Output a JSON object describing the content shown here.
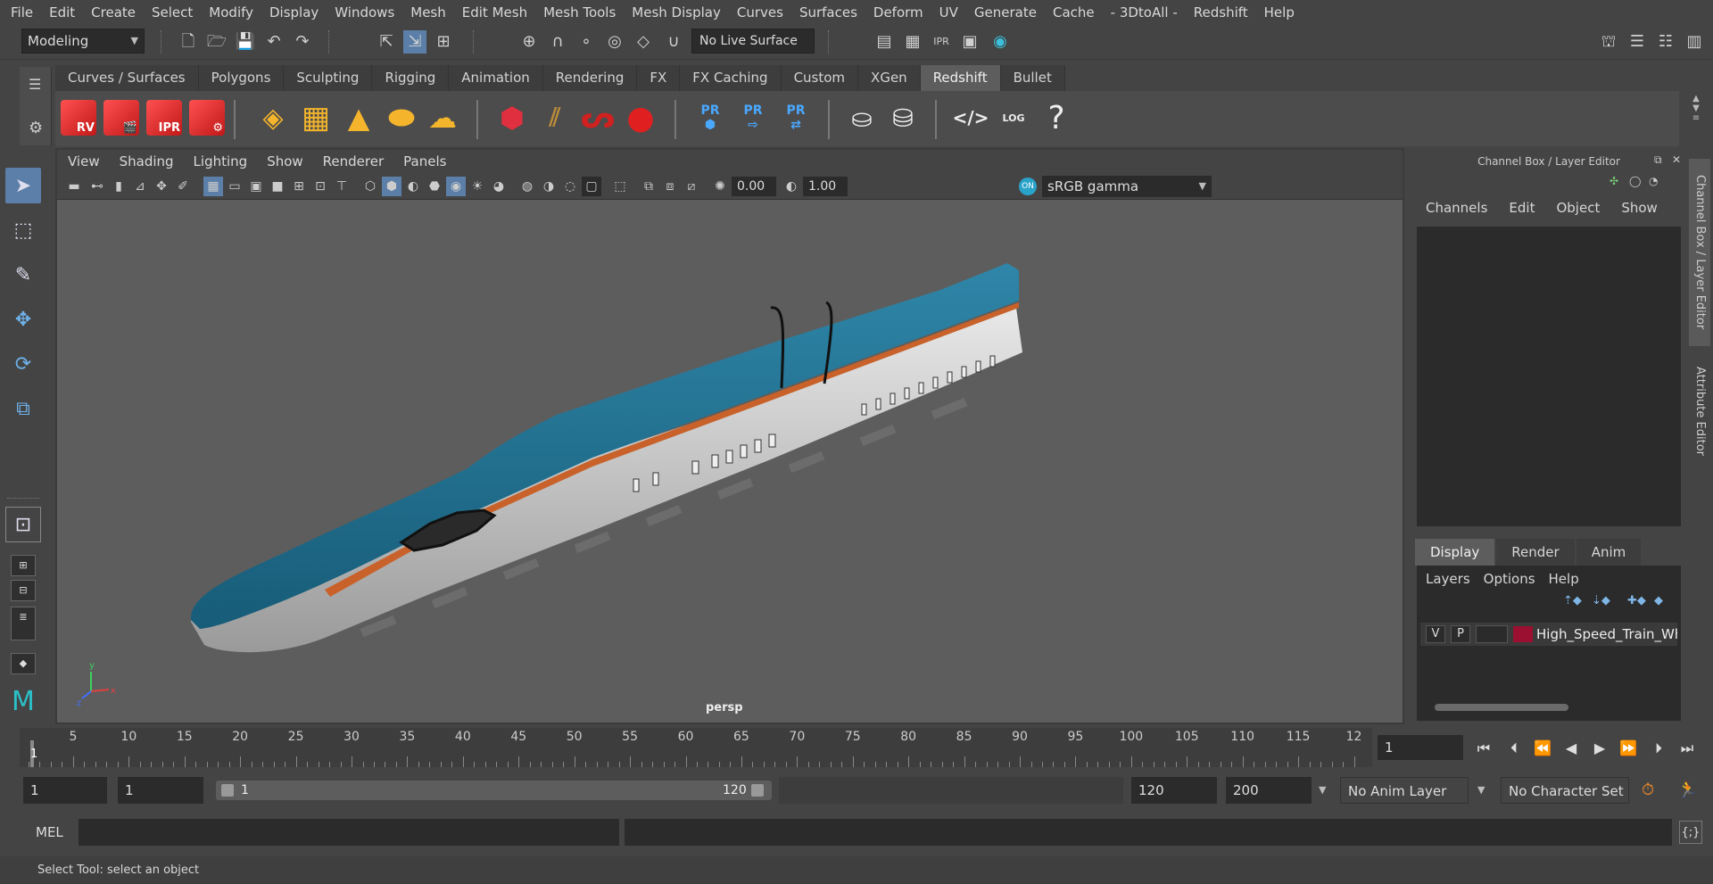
{
  "menubar": {
    "items": [
      "File",
      "Edit",
      "Create",
      "Select",
      "Modify",
      "Display",
      "Windows",
      "Mesh",
      "Edit Mesh",
      "Mesh Tools",
      "Mesh Display",
      "Curves",
      "Surfaces",
      "Deform",
      "UV",
      "Generate",
      "Cache",
      "- 3DtoAll -",
      "Redshift",
      "Help"
    ]
  },
  "statusline": {
    "workspace": "Modeling",
    "live_surface": "No Live Surface"
  },
  "shelf": {
    "tabs": [
      "Curves / Surfaces",
      "Polygons",
      "Sculpting",
      "Rigging",
      "Animation",
      "Rendering",
      "FX",
      "FX Caching",
      "Custom",
      "XGen",
      "Redshift",
      "Bullet"
    ],
    "active_tab": "Redshift",
    "rs_labels": [
      "RV",
      "",
      "IPR",
      ""
    ],
    "pr_label": "PR",
    "log_label": "LOG",
    "help_glyph": "?"
  },
  "viewport": {
    "menu": [
      "View",
      "Shading",
      "Lighting",
      "Show",
      "Renderer",
      "Panels"
    ],
    "exposure": "0.00",
    "gamma": "1.00",
    "color_space": "sRGB gamma",
    "camera": "persp",
    "axis_labels": {
      "x": "x",
      "y": "y",
      "z": "z"
    }
  },
  "channel_box": {
    "title": "Channel Box / Layer Editor",
    "menu": [
      "Channels",
      "Edit",
      "Object",
      "Show"
    ]
  },
  "layer_editor": {
    "tabs": [
      "Display",
      "Render",
      "Anim"
    ],
    "active_tab": "Display",
    "menu": [
      "Layers",
      "Options",
      "Help"
    ],
    "layer": {
      "v": "V",
      "p": "P",
      "name": "High_Speed_Train_Wh",
      "color": "#9b1030"
    }
  },
  "side_tabs": [
    "Channel Box / Layer Editor",
    "Attribute Editor"
  ],
  "timeslider": {
    "ticks": [
      "5",
      "10",
      "15",
      "20",
      "25",
      "30",
      "35",
      "40",
      "45",
      "50",
      "55",
      "60",
      "65",
      "70",
      "75",
      "80",
      "85",
      "90",
      "95",
      "100",
      "105",
      "110",
      "115",
      "12"
    ],
    "current_frame_marker": "1",
    "current_time": "1"
  },
  "range": {
    "start": "1",
    "playback_start": "1",
    "slider_start": "1",
    "slider_end": "120",
    "playback_end": "120",
    "end": "200",
    "anim_layer": "No Anim Layer",
    "character_set": "No Character Set"
  },
  "cmdline": {
    "label": "MEL",
    "script_icon": "{;}"
  },
  "helpline": {
    "text": "Select Tool: select an object"
  },
  "colors": {
    "accent": "#5b7fa8",
    "train_blue": "#1f6f8f",
    "train_white": "#d8d8d8",
    "train_stripe": "#c8622a"
  }
}
